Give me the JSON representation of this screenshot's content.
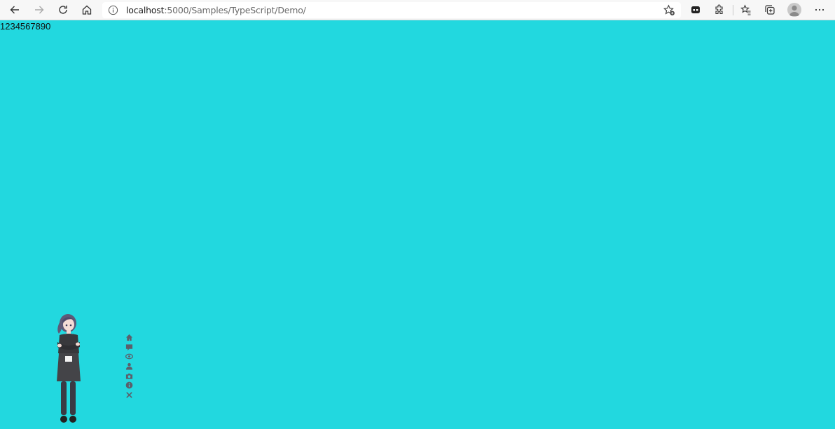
{
  "browser": {
    "address_bar": {
      "url_host": "localhost",
      "url_rest": ":5000/Samples/TypeScript/Demo/"
    },
    "icons": {
      "back": "back-arrow-icon",
      "forward": "forward-arrow-icon",
      "refresh": "refresh-icon",
      "home": "home-icon",
      "site_info": "info-icon",
      "add_favorite": "add-favorite-icon",
      "extension": "extension-icon",
      "extensions": "puzzle-icon",
      "favorites": "favorites-icon",
      "collections": "collections-icon",
      "profile": "profile-avatar-icon",
      "more": "more-options-icon"
    }
  },
  "page": {
    "background_color": "#22d8df",
    "text": "1234567890",
    "live2d_tools": [
      "home-icon",
      "chat-icon",
      "eye-icon",
      "user-icon",
      "camera-icon",
      "info-icon",
      "close-icon"
    ]
  }
}
